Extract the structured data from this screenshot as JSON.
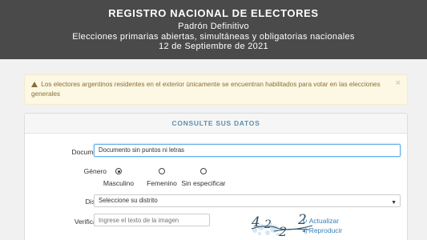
{
  "header": {
    "title": "REGISTRO NACIONAL DE ELECTORES",
    "subtitle": "Padrón Definitivo",
    "description": "Elecciones primarias abiertas, simultáneas y obligatorias nacionales",
    "date": "12 de Septiembre de 2021"
  },
  "alert": {
    "text": "Los electores argentinos residentes en el exterior únicamente se encuentran habilitados para votar en las elecciones generales",
    "close": "×",
    "icon": "warning-icon"
  },
  "panel": {
    "heading": "CONSULTE SUS DATOS"
  },
  "form": {
    "documento": {
      "label": "Documento",
      "value": "Documento sin puntos ni letras"
    },
    "genero": {
      "label": "Género",
      "options": [
        "Masculino",
        "Femenino",
        "Sin especificar"
      ],
      "selected": "Masculino"
    },
    "distrito": {
      "label": "Distrito",
      "value": "Seleccione su distrito"
    },
    "verificador": {
      "label": "Verificador",
      "placeholder": "Ingrese el texto de la imagen",
      "captcha_text": "4,2,2,2",
      "refresh_label": "Actualizar",
      "play_label": "Reproducir"
    }
  },
  "colors": {
    "header_bg": "#4a4a4a",
    "alert_bg": "#fcf8e3",
    "heading_text": "#5b8fad",
    "link": "#3a7db4"
  }
}
